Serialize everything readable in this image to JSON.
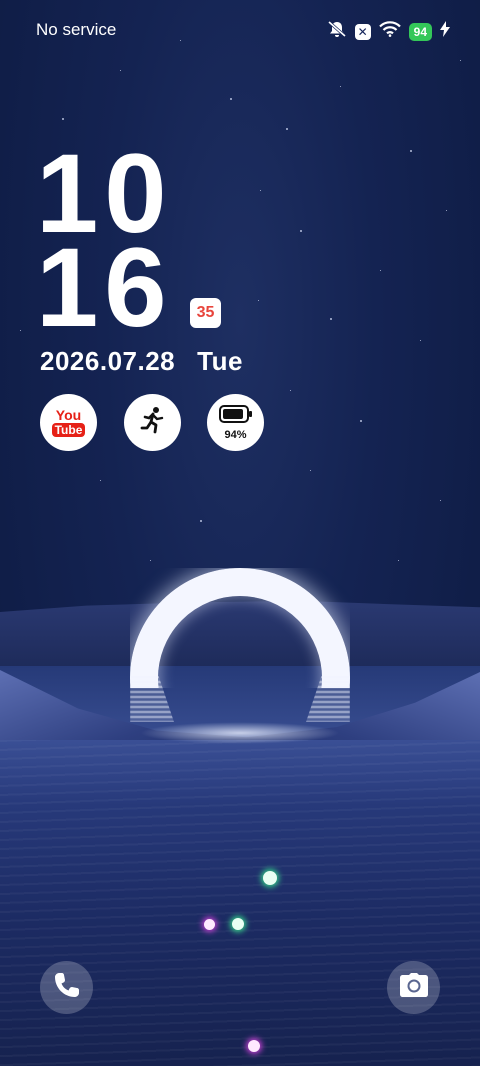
{
  "status_bar": {
    "carrier": "No service",
    "battery_level": "94"
  },
  "clock": {
    "hour": "10",
    "minute": "16",
    "seconds": "35"
  },
  "date": {
    "date": "2026.07.28",
    "weekday": "Tue"
  },
  "widgets": {
    "youtube_line1": "You",
    "youtube_line2": "Tube",
    "battery_percent": "94%"
  },
  "colors": {
    "accent_battery": "#34c759",
    "seconds_text": "#e8453c"
  },
  "icons": [
    "mute-icon",
    "close-box-icon",
    "wifi-icon",
    "charging-bolt-icon",
    "youtube-icon",
    "running-icon",
    "battery-icon",
    "phone-icon",
    "camera-icon"
  ]
}
